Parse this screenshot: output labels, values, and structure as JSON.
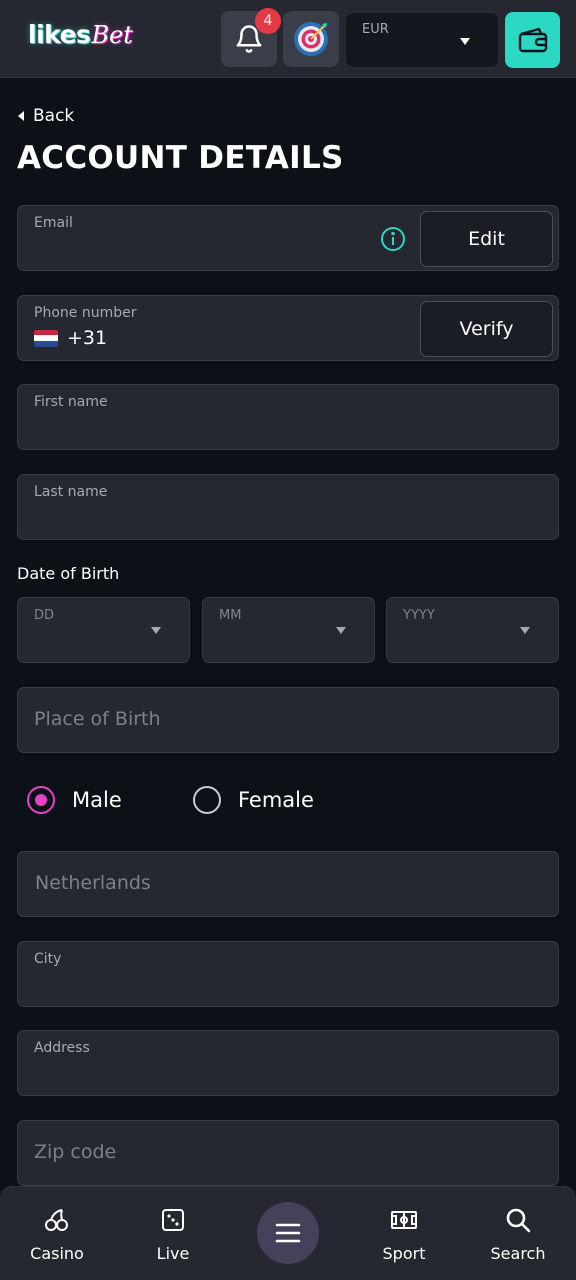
{
  "header": {
    "logo_part1": "likes",
    "logo_part2": "Bet",
    "notifications_count": "4",
    "currency_label": "EUR",
    "accent_color": "#2ad8c4"
  },
  "nav": {
    "back_label": "Back"
  },
  "page": {
    "title": "ACCOUNT DETAILS"
  },
  "form": {
    "email": {
      "label": "Email",
      "button": "Edit"
    },
    "phone": {
      "label": "Phone number",
      "code": "+31",
      "button": "Verify"
    },
    "first_name": {
      "label": "First name"
    },
    "last_name": {
      "label": "Last name"
    },
    "dob": {
      "label": "Date of Birth",
      "day_placeholder": "DD",
      "month_placeholder": "MM",
      "year_placeholder": "YYYY"
    },
    "place_of_birth": {
      "placeholder": "Place of Birth"
    },
    "gender": {
      "options": [
        "Male",
        "Female"
      ],
      "selected": "Male",
      "accent_color": "#e642c8"
    },
    "country": {
      "value": "Netherlands"
    },
    "city": {
      "label": "City"
    },
    "address": {
      "label": "Address"
    },
    "zip": {
      "placeholder": "Zip code"
    }
  },
  "bottom_nav": {
    "items": [
      {
        "label": "Casino",
        "icon": "cherries-icon"
      },
      {
        "label": "Live",
        "icon": "dice-icon"
      },
      {
        "label": "",
        "icon": "menu-icon"
      },
      {
        "label": "Sport",
        "icon": "football-field-icon"
      },
      {
        "label": "Search",
        "icon": "search-icon"
      }
    ]
  }
}
